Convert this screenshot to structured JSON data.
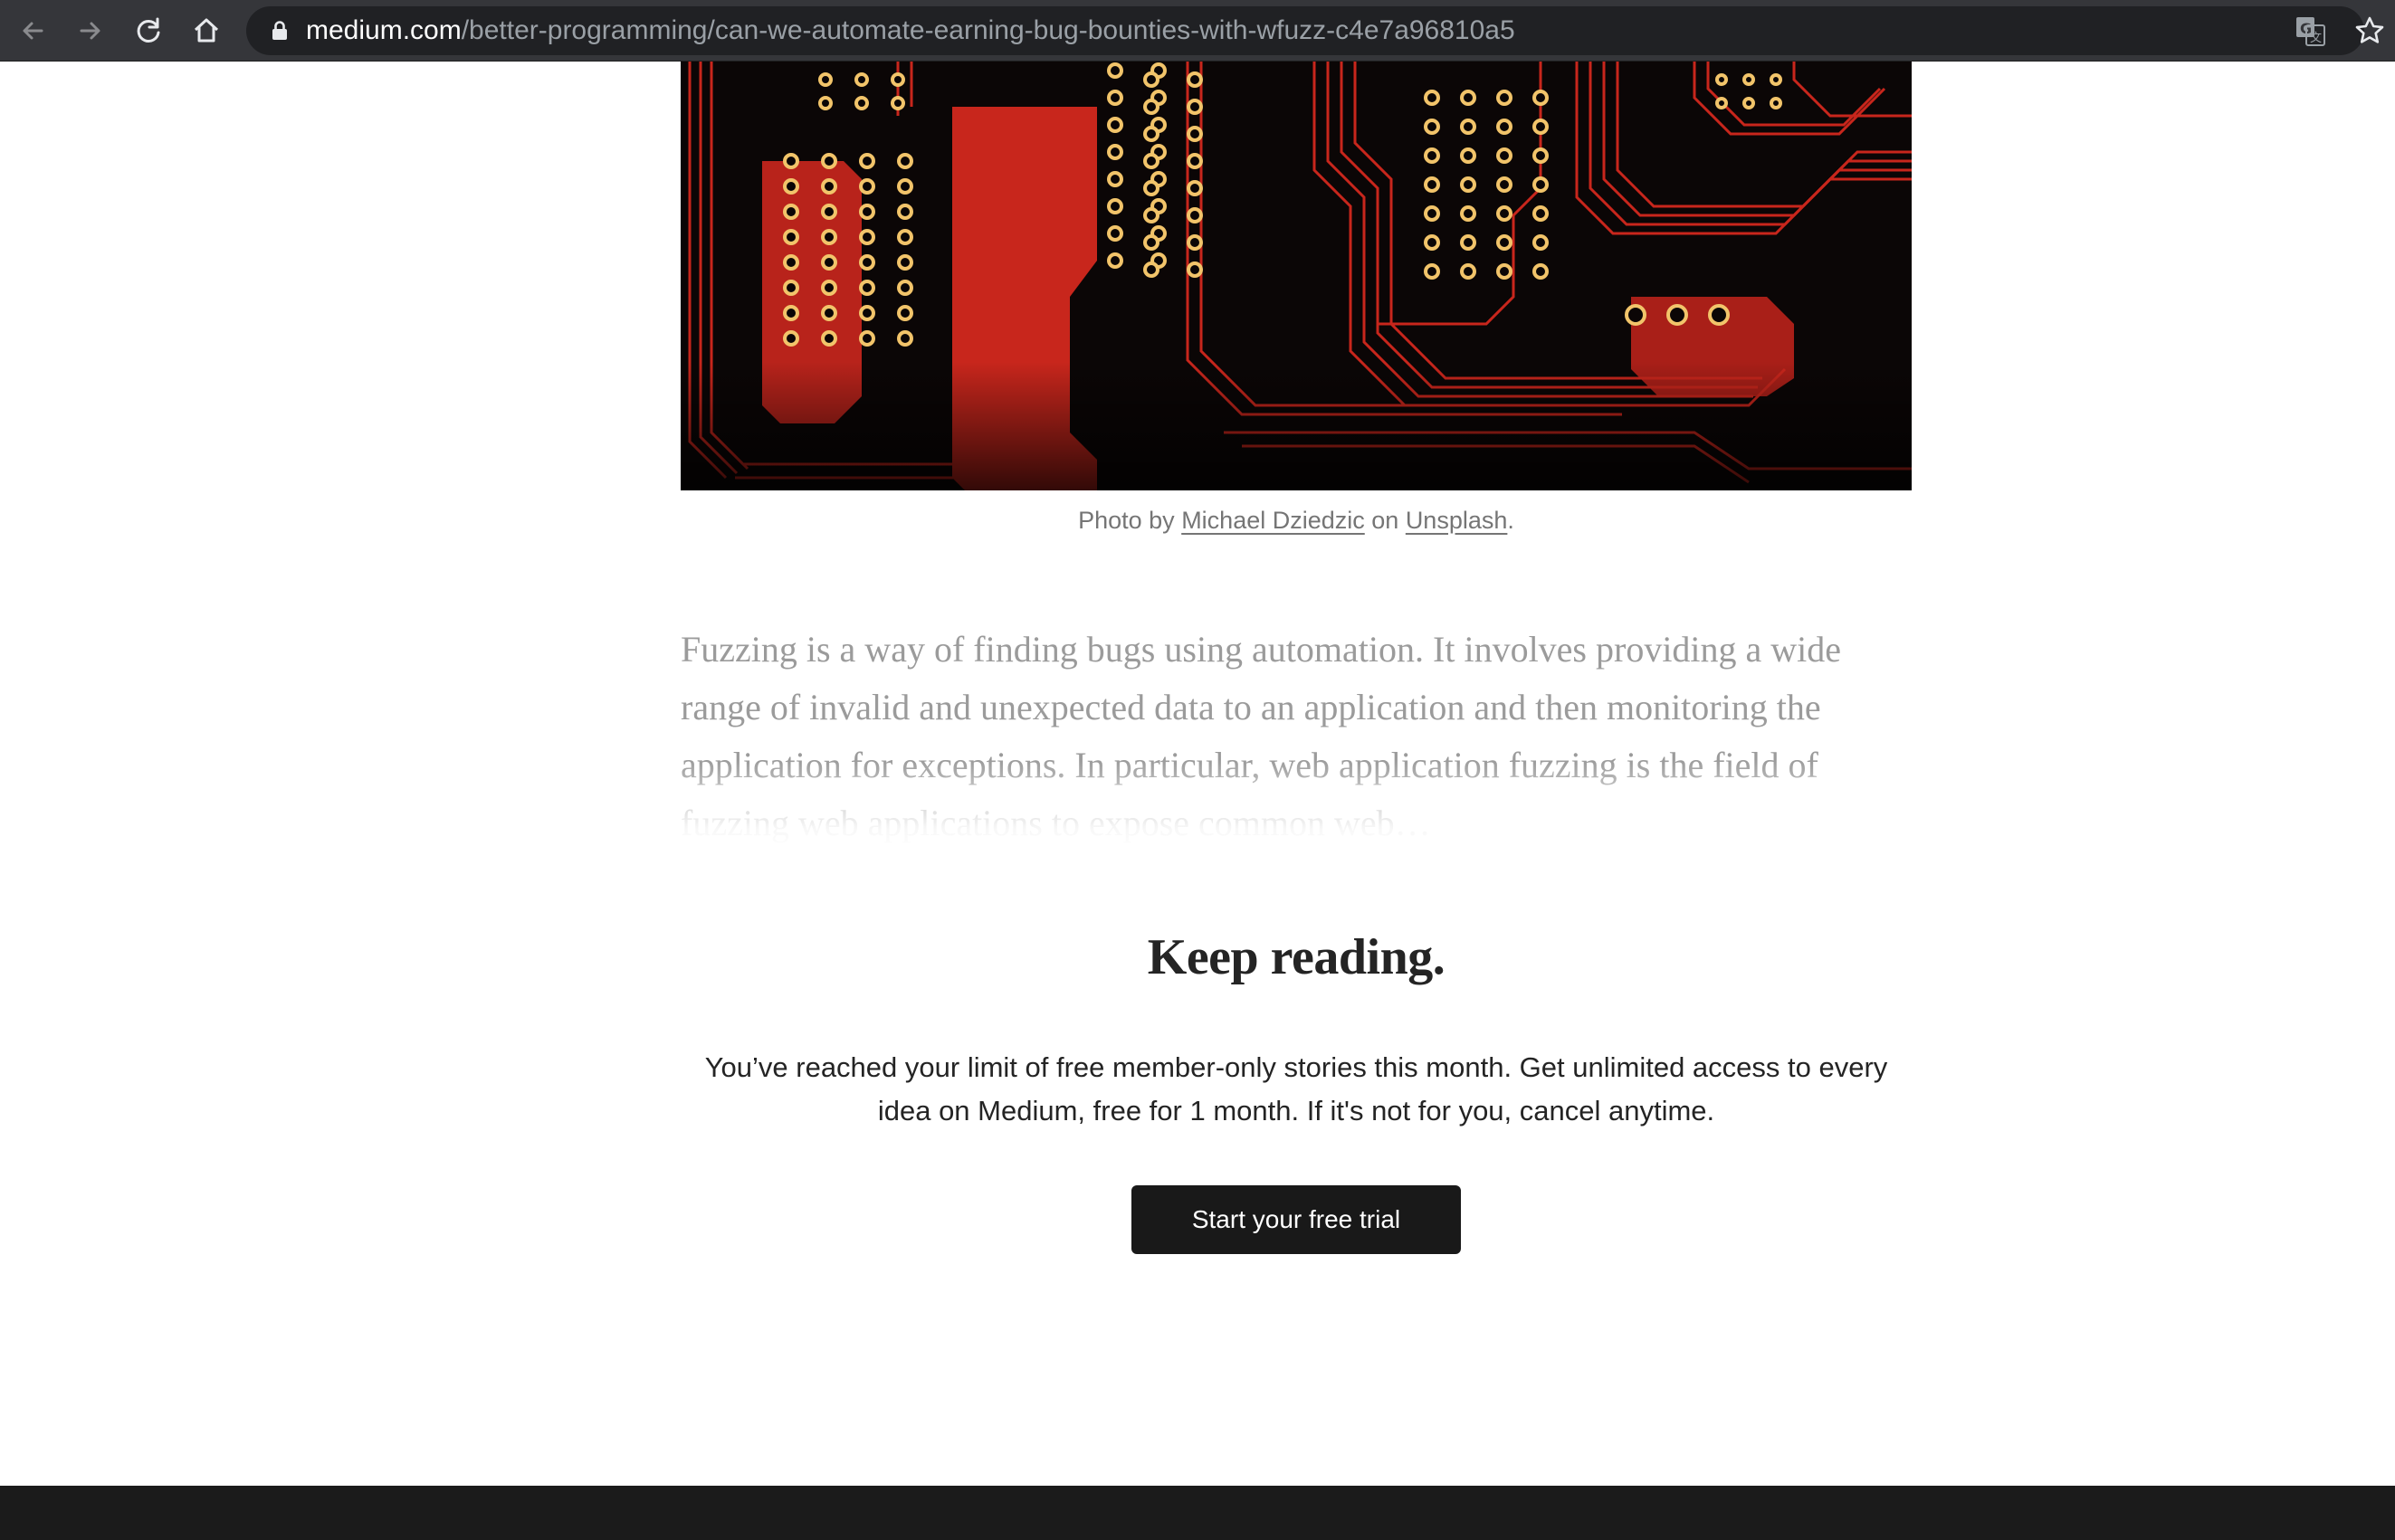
{
  "browser": {
    "url_host": "medium.com",
    "url_path": "/better-programming/can-we-automate-earning-bug-bounties-with-wfuzz-c4e7a96810a5",
    "icons": [
      "back-icon",
      "forward-icon",
      "reload-icon",
      "home-icon",
      "lock-icon",
      "translate-icon",
      "star-icon"
    ]
  },
  "article": {
    "hero_image": "red circuit board photo",
    "caption": {
      "prefix": "Photo by ",
      "author": "Michael Dziedzic",
      "middle": " on ",
      "source": "Unsplash",
      "suffix": "."
    },
    "teaser": "Fuzzing is a way of finding bugs using automation. It involves providing a wide range of invalid and unexpected data to an application and then monitoring the application for exceptions. In particular, web application fuzzing is the field of fuzzing web applications to expose common web…"
  },
  "paywall": {
    "title": "Keep reading.",
    "message": "You’ve reached your limit of free member-only stories this month. Get unlimited access to every idea on Medium, free for 1 month. If it's not for you, cancel anytime.",
    "cta_label": "Start your free trial"
  },
  "colors": {
    "chrome_bg": "#35363a",
    "omnibox_bg": "#202124",
    "circuit_red": "#c8261c",
    "cta_bg": "#191919",
    "footer_bg": "#1b1b1b"
  }
}
